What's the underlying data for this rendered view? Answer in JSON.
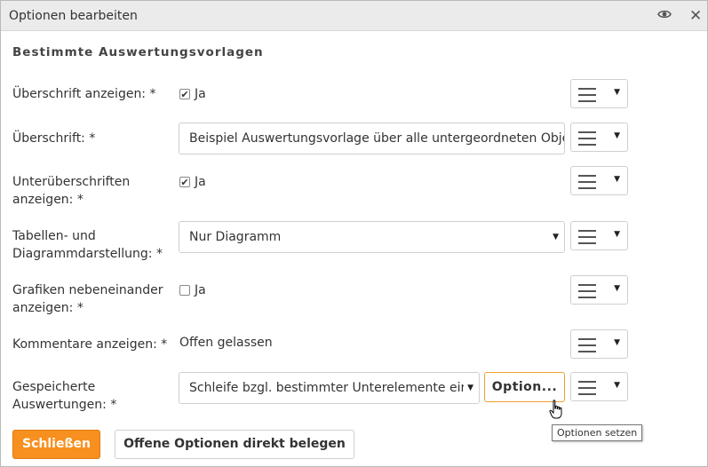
{
  "dialog": {
    "title": "Optionen bearbeiten",
    "icons": {
      "view": "eye-icon",
      "close": "close-icon"
    },
    "section_title": "Bestimmte Auswertungsvorlagen"
  },
  "fields": {
    "show_heading": {
      "label": "Überschrift anzeigen: *",
      "checked": true,
      "checkbox_label": "Ja"
    },
    "heading": {
      "label": "Überschrift: *",
      "value": "Beispiel Auswertungsvorlage über alle untergeordneten Obje"
    },
    "show_subheadings": {
      "label_line1": "Unterüberschriften",
      "label_line2": "anzeigen: *",
      "checked": true,
      "checkbox_label": "Ja"
    },
    "table_chart": {
      "label_line1": "Tabellen- und",
      "label_line2": "Diagrammdarstellung: *",
      "selected": "Nur Diagramm"
    },
    "graphics_side_by_side": {
      "label_line1": "Grafiken nebeneinander",
      "label_line2": "anzeigen: *",
      "checked": false,
      "checkbox_label": "Ja"
    },
    "show_comments": {
      "label": "Kommentare anzeigen: *",
      "value": "Offen gelassen"
    },
    "saved_evaluations": {
      "label_line1": "Gespeicherte",
      "label_line2": "Auswertungen: *",
      "selected": "Schleife bzgl. bestimmter Unterelemente eir",
      "option_button": "Option...",
      "tooltip": "Optionen setzen"
    }
  },
  "footer": {
    "close_button": "Schließen",
    "assign_button": "Offene Optionen direkt belegen"
  },
  "colors": {
    "primary": "#f7901e",
    "option_border": "#f0a030",
    "titlebar": "#ebebeb"
  }
}
